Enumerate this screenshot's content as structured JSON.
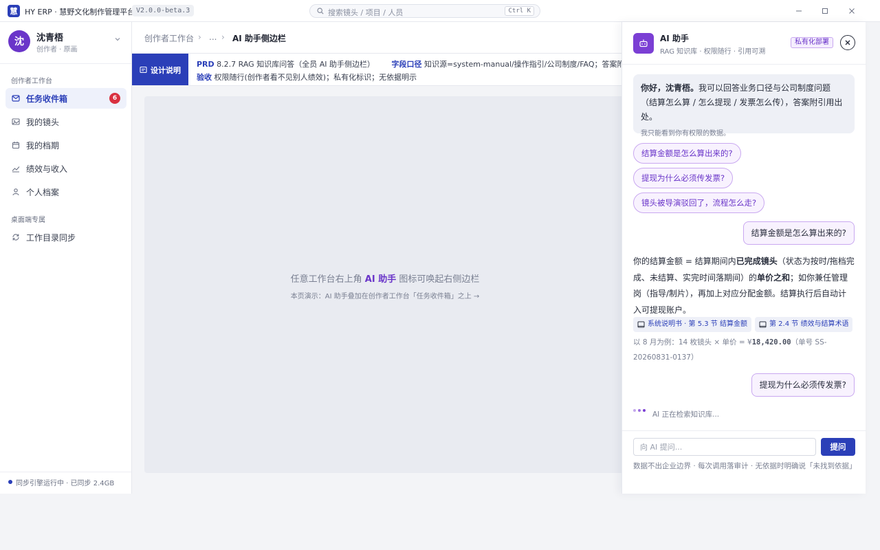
{
  "app": {
    "logo_char": "慧",
    "title": "HY ERP · 慧野文化制作管理平台",
    "version": "V2.0.0-beta.3"
  },
  "search": {
    "placeholder": "搜索镜头 / 项目 / 人员",
    "shortcut": "Ctrl K"
  },
  "window_controls": [
    "minimize-icon",
    "maximize-icon",
    "close-icon"
  ],
  "user": {
    "avatar_char": "沈",
    "name": "沈青梧",
    "role": "创作者 · 原画"
  },
  "sidebar": {
    "section1": "创作者工作台",
    "items": [
      {
        "label": "任务收件箱",
        "icon": "inbox-icon",
        "badge": "6",
        "active": true
      },
      {
        "label": "我的镜头",
        "icon": "image-icon"
      },
      {
        "label": "我的档期",
        "icon": "calendar-icon"
      },
      {
        "label": "绩效与收入",
        "icon": "chart-icon"
      },
      {
        "label": "个人档案",
        "icon": "user-icon"
      }
    ],
    "section2": "桌面端专属",
    "desktop_items": [
      {
        "label": "工作目录同步",
        "icon": "sync-icon"
      }
    ],
    "sync_status": "同步引擎运行中 · 已同步 2.4GB"
  },
  "breadcrumb": {
    "root": "创作者工作台",
    "ellipsis": "...",
    "current": "AI 助手侧边栏"
  },
  "design_note": {
    "tag": "设计说明",
    "line1_prd_label": "PRD",
    "line1_prd_text": "8.2.7 RAG 知识库问答（全员 AI 助手侧边栏）",
    "line1_field_label": "字段口径",
    "line1_field_text": "知识源=system-manual/操作指引/公司制度/FAQ；答案附引用出处",
    "line2_accept_label": "验收",
    "line2_accept_text": "权限随行(创作者看不见别人绩效)；私有化标识；无依据明示"
  },
  "canvas": {
    "hint_prefix": "任意工作台右上角",
    "hint_highlight": "AI 助手",
    "hint_suffix": "图标可唤起右侧边栏",
    "sub": "本页演示：AI 助手叠加在创作者工作台「任务收件箱」之上 →"
  },
  "ai": {
    "title": "AI 助手",
    "subtitle": "RAG 知识库 · 权限随行 · 引用可溯",
    "private_tag": "私有化部署",
    "greeting_bold": "你好，沈青梧。",
    "greeting_text": "我可以回答业务口径与公司制度问题（结算怎么算 / 怎么提现 / 发票怎么传），答案附引用出处。",
    "greeting_note": "我只能看到你有权限的数据。",
    "suggestions": [
      "结算金额是怎么算出来的?",
      "提现为什么必须传发票?",
      "镜头被导演驳回了，流程怎么走?"
    ],
    "user_q1": "结算金额是怎么算出来的?",
    "answer_p1": "你的结算金额 = 结算期间内",
    "answer_b1": "已完成镜头",
    "answer_p2": "（状态为按时/拖档完成、未结算、实完时间落期间）的",
    "answer_b2": "单价之和",
    "answer_p3": "；如你兼任管理岗（指导/制片），再加上对应分配金额。结算执行后自动计入可提现账户。",
    "citations": [
      "系统说明书 · 第 5.3 节 结算金额",
      "第 2.4 节 绩效与结算术语"
    ],
    "example_prefix": "以 8 月为例：14 枚镜头 × 单价 = ¥",
    "example_amount": "18,420.00",
    "example_suffix": "（单号 SS-20260831-0137）",
    "user_q2": "提现为什么必须传发票?",
    "typing": "AI 正在检索知识库...",
    "input_placeholder": "向 AI 提问...",
    "ask_button": "提问",
    "disclaimer": "数据不出企业边界 · 每次调用落审计 · 无依据时明确说「未找到依据」"
  },
  "colors": {
    "brand": "#2b3fb8",
    "ai_purple": "#6a35c9",
    "badge_red": "#d93040"
  }
}
